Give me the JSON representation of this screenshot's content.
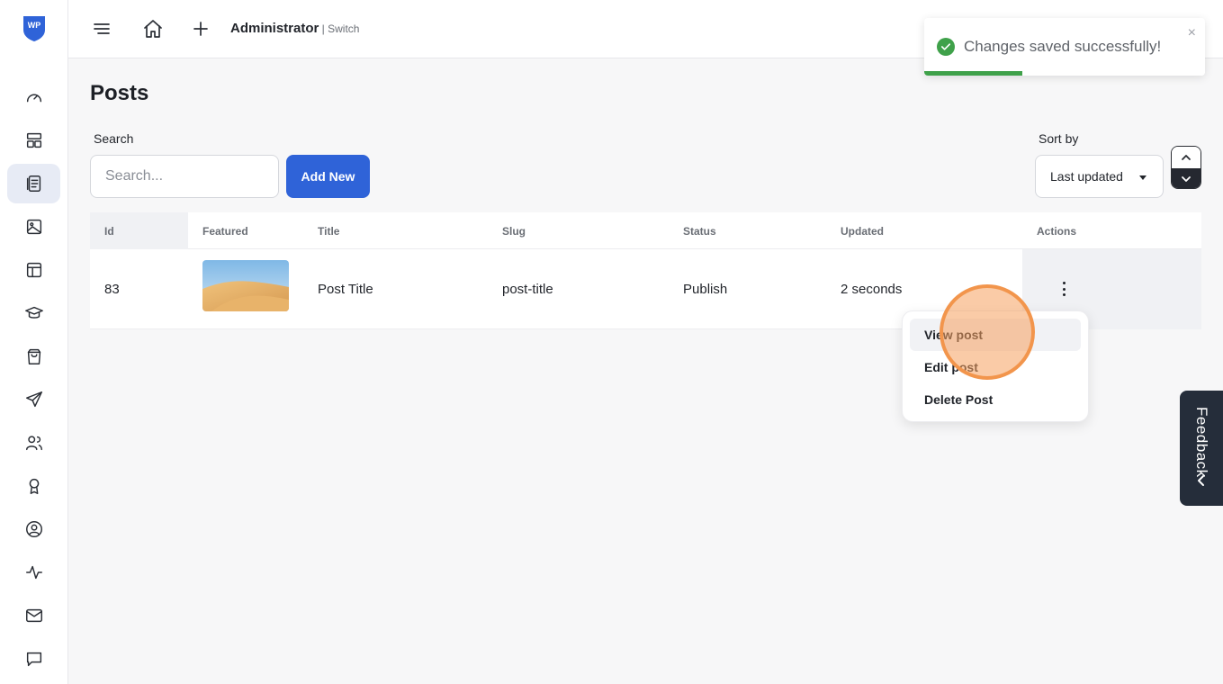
{
  "app": {
    "logo_text": "WP"
  },
  "sidebar": {
    "items": [
      {
        "icon": "dashboard-gauge-icon"
      },
      {
        "icon": "layout-blocks-icon"
      },
      {
        "icon": "posts-document-icon",
        "active": true
      },
      {
        "icon": "image-icon"
      },
      {
        "icon": "template-layout-icon"
      },
      {
        "icon": "graduation-cap-icon"
      },
      {
        "icon": "shopping-bag-icon"
      },
      {
        "icon": "paper-plane-icon"
      },
      {
        "icon": "users-icon"
      },
      {
        "icon": "award-badge-icon"
      },
      {
        "icon": "user-circle-icon"
      },
      {
        "icon": "activity-pulse-icon"
      },
      {
        "icon": "mail-icon"
      },
      {
        "icon": "chat-bubble-icon"
      }
    ]
  },
  "topbar": {
    "user_name": "Administrator",
    "separator": " | ",
    "switch_label": "Switch"
  },
  "page": {
    "title": "Posts"
  },
  "search": {
    "label": "Search",
    "placeholder": "Search...",
    "value": ""
  },
  "add_new_label": "Add New",
  "sort": {
    "label": "Sort by",
    "selected": "Last updated"
  },
  "table": {
    "headers": [
      "Id",
      "Featured",
      "Title",
      "Slug",
      "Status",
      "Updated",
      "Actions"
    ],
    "rows": [
      {
        "id": "83",
        "title": "Post Title",
        "slug": "post-title",
        "status": "Publish",
        "updated": "2 seconds"
      }
    ]
  },
  "actions_menu": {
    "items": [
      "View post",
      "Edit post",
      "Delete Post"
    ]
  },
  "toast": {
    "message": "Changes saved successfully!",
    "close": "×",
    "progress": 0.35,
    "accent": "#3fa14a"
  },
  "feedback": {
    "label": "Feedback"
  },
  "colors": {
    "primary": "#2f63d8",
    "sidebar_active": "#e7ebf5",
    "pointer": "#f2954c"
  }
}
